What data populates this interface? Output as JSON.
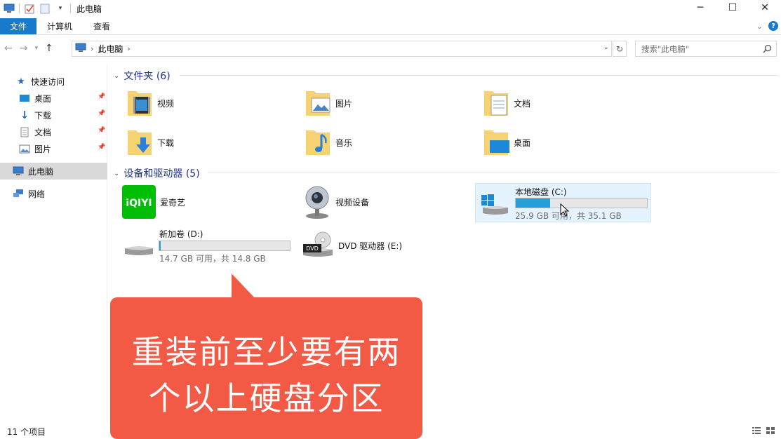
{
  "window": {
    "title": "此电脑",
    "min_glyph": "─",
    "max_glyph": "☐",
    "close_glyph": "✕"
  },
  "ribbon": {
    "tabs": [
      "文件",
      "计算机",
      "查看"
    ]
  },
  "address": {
    "path": "此电脑",
    "search_placeholder": "搜索\"此电脑\""
  },
  "sidebar": {
    "quick_access": "快速访问",
    "pinned": [
      "桌面",
      "下载",
      "文档",
      "图片"
    ],
    "this_pc": "此电脑",
    "network": "网络"
  },
  "folders": {
    "heading": "文件夹 (6)",
    "items": [
      "视频",
      "图片",
      "文档",
      "下载",
      "音乐",
      "桌面"
    ]
  },
  "devices": {
    "heading": "设备和驱动器 (5)",
    "iqiyi": "爱奇艺",
    "camera": "视频设备",
    "drive_c": {
      "name": "本地磁盘 (C:)",
      "info": "25.9 GB 可用，共 35.1 GB",
      "used_fraction": 0.26
    },
    "drive_d": {
      "name": "新加卷 (D:)",
      "info": "14.7 GB 可用，共 14.8 GB",
      "used_fraction": 0.01
    },
    "dvd": "DVD 驱动器 (E:)",
    "iqiyi_logo": "iQIYI",
    "dvd_badge": "DVD"
  },
  "status": {
    "items": "11 个项目"
  },
  "caption": {
    "line1": "重装前至少要有两",
    "line2": "个以上硬盘分区"
  },
  "colors": {
    "accent": "#1979ca",
    "caption_bg": "#f35a45",
    "drive_fill": "#26a0da"
  }
}
